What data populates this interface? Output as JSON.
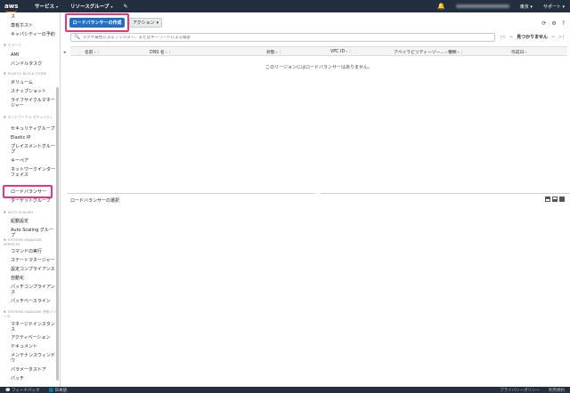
{
  "nav": {
    "logo": "aws",
    "services": "サービス",
    "resource_groups": "リソースグループ",
    "region": "東京",
    "support": "サポート"
  },
  "sidebar": {
    "items": [
      {
        "label": "ス",
        "type": "item"
      },
      {
        "label": "専有ホスト",
        "type": "item"
      },
      {
        "label": "キャパシティーの予約",
        "type": "item"
      },
      {
        "label": "イメージ",
        "type": "section"
      },
      {
        "label": "AMI",
        "type": "item"
      },
      {
        "label": "バンドルタスク",
        "type": "item"
      },
      {
        "label": "ELASTIC BLOCK STORE",
        "type": "section"
      },
      {
        "label": "ボリューム",
        "type": "item"
      },
      {
        "label": "スナップショット",
        "type": "item"
      },
      {
        "label": "ライフサイクルマネージャー",
        "type": "item"
      },
      {
        "label": "ネットワーク & セキュリティ",
        "type": "section"
      },
      {
        "label": "セキュリティグループ",
        "type": "item"
      },
      {
        "label": "Elastic IP",
        "type": "item"
      },
      {
        "label": "プレイスメントグループ",
        "type": "item"
      },
      {
        "label": "キーペア",
        "type": "item"
      },
      {
        "label": "ネットワークインターフェイス",
        "type": "item"
      },
      {
        "label": "ロードバランサー",
        "type": "item"
      },
      {
        "label": "ターゲットグループ",
        "type": "item"
      },
      {
        "label": "AUTO SCALING",
        "type": "section"
      },
      {
        "label": "起動設定",
        "type": "item"
      },
      {
        "label": "Auto Scaling グループ",
        "type": "item"
      },
      {
        "label": "SYSTEMS MANAGER SERVICES",
        "type": "section"
      },
      {
        "label": "コマンドの実行",
        "type": "item"
      },
      {
        "label": "ステートマネージャー",
        "type": "item"
      },
      {
        "label": "設定コンプライアンス",
        "type": "item"
      },
      {
        "label": "自動化",
        "type": "item"
      },
      {
        "label": "パッチコンプライアンス",
        "type": "item"
      },
      {
        "label": "パッチベースライン",
        "type": "item"
      },
      {
        "label": "SYSTEMS MANAGER 共有リソース",
        "type": "section"
      },
      {
        "label": "マネージドインスタンス",
        "type": "item"
      },
      {
        "label": "アクティベーション",
        "type": "item"
      },
      {
        "label": "ドキュメント",
        "type": "item"
      },
      {
        "label": "メンテナンスウィンドウ",
        "type": "item"
      },
      {
        "label": "パラメータストア",
        "type": "item"
      },
      {
        "label": "パッチ",
        "type": "item"
      }
    ]
  },
  "toolbar": {
    "create_label": "ロードバランサーの作成",
    "actions_label": "アクション"
  },
  "search": {
    "placeholder": "タグや属性によるフィルター、またはキーワードによる検索"
  },
  "pager": {
    "text": "見つかりません"
  },
  "table": {
    "columns": [
      "名前",
      "DNS 名",
      "状態",
      "VPC ID",
      "アベイラビリティーゾー…",
      "種類",
      "作成日"
    ],
    "empty_message": "このリージョンにはロードバランサーはありません。"
  },
  "detail": {
    "title": "ロードバランサーの選択"
  },
  "footer": {
    "feedback": "フィードバック",
    "language": "日本語",
    "privacy": "プライバシーポリシー",
    "terms": "利用規約"
  }
}
